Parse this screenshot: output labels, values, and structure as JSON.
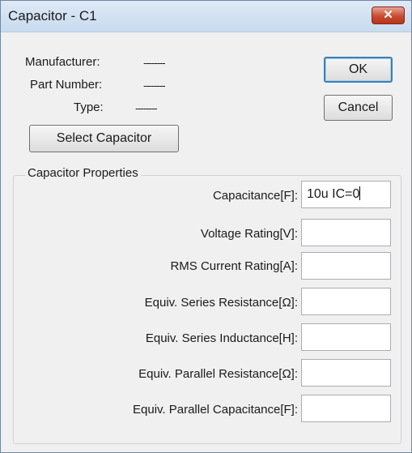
{
  "window": {
    "title": "Capacitor - C1",
    "close_glyph": "✕"
  },
  "info": [
    {
      "label": "Manufacturer:",
      "value": "--------"
    },
    {
      "label": "Part Number:",
      "value": "--------"
    },
    {
      "label": "Type:",
      "value": "--------"
    }
  ],
  "buttons": {
    "ok": "OK",
    "cancel": "Cancel",
    "select": "Select Capacitor"
  },
  "group": {
    "title": "Capacitor Properties"
  },
  "fields": [
    {
      "label": "Capacitance[F]:",
      "value": "10u IC=0"
    },
    {
      "label": "Voltage Rating[V]:",
      "value": ""
    },
    {
      "label": "RMS Current Rating[A]:",
      "value": ""
    },
    {
      "label": "Equiv. Series Resistance[Ω]:",
      "value": ""
    },
    {
      "label": "Equiv. Series Inductance[H]:",
      "value": ""
    },
    {
      "label": "Equiv. Parallel Resistance[Ω]:",
      "value": ""
    },
    {
      "label": "Equiv. Parallel Capacitance[F]:",
      "value": ""
    }
  ]
}
